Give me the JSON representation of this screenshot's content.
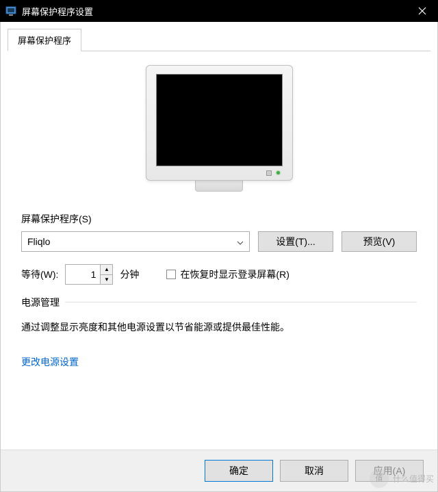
{
  "window": {
    "title": "屏幕保护程序设置"
  },
  "tab": {
    "label": "屏幕保护程序"
  },
  "screensaver": {
    "section_label": "屏幕保护程序(S)",
    "selected": "Fliqlo",
    "settings_btn": "设置(T)...",
    "preview_btn": "预览(V)",
    "wait_label": "等待(W):",
    "wait_value": "1",
    "wait_unit": "分钟",
    "resume_checkbox": "在恢复时显示登录屏幕(R)"
  },
  "power": {
    "heading": "电源管理",
    "description": "通过调整显示亮度和其他电源设置以节省能源或提供最佳性能。",
    "link": "更改电源设置"
  },
  "buttons": {
    "ok": "确定",
    "cancel": "取消",
    "apply": "应用(A)"
  },
  "watermark": {
    "badge": "值",
    "text": "什么值得买"
  }
}
